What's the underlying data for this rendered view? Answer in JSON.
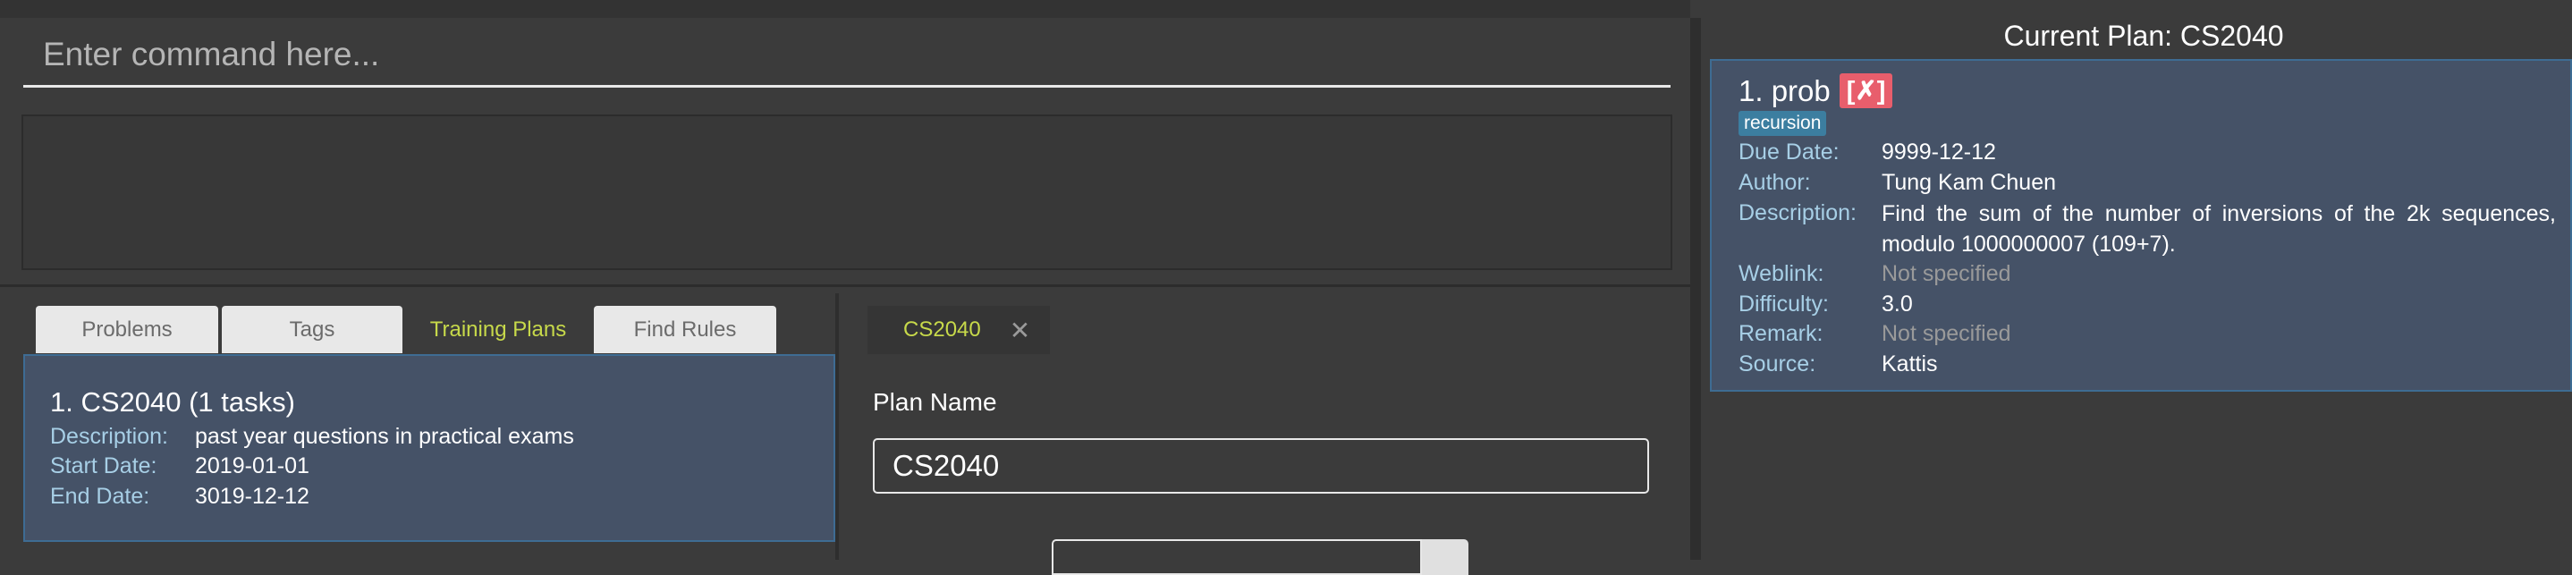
{
  "command": {
    "placeholder": "Enter command here..."
  },
  "tabs": [
    {
      "label": "Problems"
    },
    {
      "label": "Tags"
    },
    {
      "label": "Training Plans"
    },
    {
      "label": "Find Rules"
    }
  ],
  "plan_list": {
    "item": {
      "title": "1.  CS2040 (1 tasks)",
      "description_label": "Description:",
      "description": "past year questions in practical exams",
      "start_label": "Start Date:",
      "start": "2019-01-01",
      "end_label": "End Date:",
      "end": "3019-12-12"
    }
  },
  "detail": {
    "tab_label": "CS2040",
    "tab_close": "✕",
    "plan_name_label": "Plan Name",
    "plan_name_value": "CS2040"
  },
  "current_plan": {
    "title": "Current Plan: CS2040",
    "problem": {
      "title": "1.  prob",
      "mark": "[✗]",
      "tag": "recursion",
      "due_label": "Due Date:",
      "due": "9999-12-12",
      "author_label": "Author:",
      "author": "Tung Kam Chuen",
      "desc_label": "Description:",
      "desc": "Find the sum of the number of inversions of the 2k sequences, modulo 1000000007 (109+7).",
      "weblink_label": "Weblink:",
      "weblink": "Not specified",
      "difficulty_label": "Difficulty:",
      "difficulty": "3.0",
      "remark_label": "Remark:",
      "remark": "Not specified",
      "source_label": "Source:",
      "source": "Kattis"
    }
  },
  "colors": {
    "accent": "#c7d94a",
    "card": "#455267",
    "label": "#a7cfe6",
    "danger": "#e85e6c",
    "tag": "#3c7ea0"
  }
}
